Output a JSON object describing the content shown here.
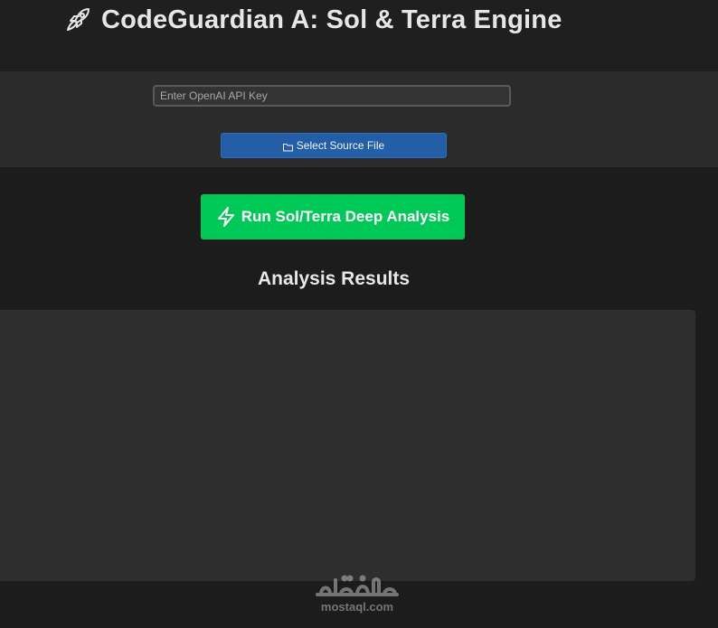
{
  "header": {
    "title": "CodeGuardian A: Sol & Terra Engine",
    "icon": "rocket-icon"
  },
  "controls": {
    "api_key_placeholder": "Enter OpenAI API Key",
    "api_key_value": "",
    "select_file_label": "Select Source File",
    "select_file_icon": "folder-icon"
  },
  "actions": {
    "run_label": "Run Sol/Terra Deep Analysis",
    "run_icon": "lightning-bolt-icon"
  },
  "results": {
    "heading": "Analysis Results",
    "content": ""
  },
  "watermark": {
    "text": "mostaql.com"
  },
  "colors": {
    "background": "#1c1c1c",
    "band": "#2b2b2b",
    "panel": "#2e2e2e",
    "select_button": "#245ea6",
    "run_button": "#00c957"
  }
}
